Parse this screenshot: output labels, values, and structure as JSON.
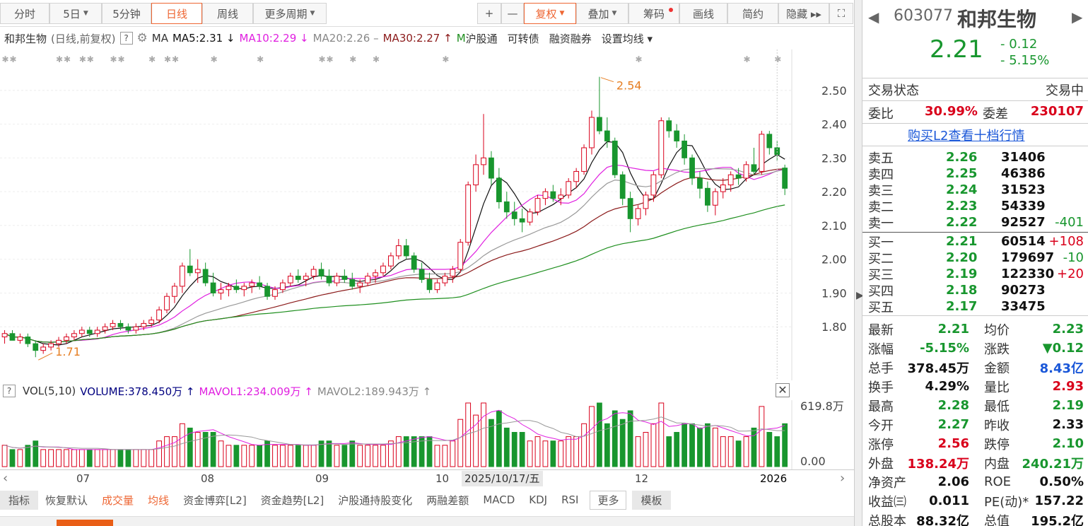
{
  "toolbar": {
    "items": [
      {
        "label": "分时",
        "x": 0,
        "w": 70
      },
      {
        "label": "5日",
        "x": 70,
        "w": 74,
        "dropdown": true
      },
      {
        "label": "5分钟",
        "x": 144,
        "w": 70
      },
      {
        "label": "日线",
        "x": 214,
        "w": 72,
        "active": true
      },
      {
        "label": "周线",
        "x": 286,
        "w": 72
      },
      {
        "label": "更多周期",
        "x": 358,
        "w": 104,
        "dropdown": true
      }
    ],
    "right": [
      {
        "label": "+",
        "x": 675,
        "w": 34
      },
      {
        "label": "—",
        "x": 709,
        "w": 32
      },
      {
        "label": "复权",
        "x": 741,
        "w": 74,
        "dropdown": true,
        "active": true
      },
      {
        "label": "叠加",
        "x": 815,
        "w": 74,
        "dropdown": true
      },
      {
        "label": "筹码",
        "x": 889,
        "w": 72,
        "dot": true
      },
      {
        "label": "画线",
        "x": 961,
        "w": 68
      },
      {
        "label": "简约",
        "x": 1029,
        "w": 72
      },
      {
        "label": "隐藏 ▸▸",
        "x": 1101,
        "w": 72
      },
      {
        "label": "⛶",
        "x": 1173,
        "w": 34
      }
    ]
  },
  "ma_legend": {
    "title": "和邦生物",
    "subtitle": "(日线,前复权)",
    "ma": "MA",
    "ma5": "MA5:2.31 ↓",
    "ma10": "MA10:2.29 ↓",
    "ma20": "MA20:2.26 –",
    "ma30": "MA30:2.27 ↑",
    "links": [
      "沪股通",
      "可转债",
      "融资融券",
      "设置均线 ▾"
    ]
  },
  "colors": {
    "up": "#d9001b",
    "down": "#18962e",
    "ma5": "#111111",
    "ma10": "#e020e0",
    "ma20": "#999999",
    "ma30": "#8b1a1a",
    "ma60": "#1f8f1f"
  },
  "chart_data": {
    "type": "candlestick",
    "ylim": [
      1.7,
      2.6
    ],
    "y_ticks": [
      "2.50",
      "2.40",
      "2.30",
      "2.20",
      "2.10",
      "2.00",
      "1.90",
      "1.80"
    ],
    "x_labels": [
      "07",
      "08",
      "09",
      "10",
      "12"
    ],
    "annotations": [
      "2.54",
      "1.71"
    ],
    "selected_date": "2025/10/17/五",
    "year_label": "2026",
    "ohlc": [
      [
        1.77,
        1.79,
        1.75,
        1.78
      ],
      [
        1.78,
        1.79,
        1.76,
        1.76
      ],
      [
        1.76,
        1.78,
        1.75,
        1.77
      ],
      [
        1.77,
        1.78,
        1.74,
        1.75
      ],
      [
        1.75,
        1.76,
        1.71,
        1.73
      ],
      [
        1.73,
        1.75,
        1.72,
        1.74
      ],
      [
        1.74,
        1.76,
        1.73,
        1.75
      ],
      [
        1.75,
        1.77,
        1.74,
        1.76
      ],
      [
        1.76,
        1.78,
        1.75,
        1.77
      ],
      [
        1.77,
        1.79,
        1.76,
        1.78
      ],
      [
        1.78,
        1.8,
        1.77,
        1.79
      ],
      [
        1.79,
        1.8,
        1.77,
        1.78
      ],
      [
        1.78,
        1.8,
        1.77,
        1.79
      ],
      [
        1.79,
        1.81,
        1.78,
        1.8
      ],
      [
        1.8,
        1.82,
        1.79,
        1.81
      ],
      [
        1.81,
        1.82,
        1.79,
        1.8
      ],
      [
        1.8,
        1.81,
        1.78,
        1.79
      ],
      [
        1.79,
        1.81,
        1.78,
        1.8
      ],
      [
        1.8,
        1.82,
        1.79,
        1.81
      ],
      [
        1.81,
        1.83,
        1.8,
        1.82
      ],
      [
        1.82,
        1.86,
        1.81,
        1.85
      ],
      [
        1.85,
        1.9,
        1.84,
        1.89
      ],
      [
        1.89,
        1.93,
        1.87,
        1.92
      ],
      [
        1.92,
        1.99,
        1.9,
        1.98
      ],
      [
        1.98,
        2.03,
        1.95,
        1.96
      ],
      [
        1.96,
        2.0,
        1.93,
        1.97
      ],
      [
        1.97,
        1.99,
        1.92,
        1.93
      ],
      [
        1.93,
        1.96,
        1.89,
        1.9
      ],
      [
        1.9,
        1.93,
        1.88,
        1.91
      ],
      [
        1.91,
        1.93,
        1.89,
        1.92
      ],
      [
        1.92,
        1.94,
        1.9,
        1.91
      ],
      [
        1.91,
        1.93,
        1.89,
        1.92
      ],
      [
        1.92,
        1.94,
        1.9,
        1.93
      ],
      [
        1.93,
        1.95,
        1.91,
        1.92
      ],
      [
        1.92,
        1.93,
        1.88,
        1.89
      ],
      [
        1.89,
        1.92,
        1.88,
        1.91
      ],
      [
        1.91,
        1.94,
        1.9,
        1.93
      ],
      [
        1.93,
        1.96,
        1.92,
        1.95
      ],
      [
        1.95,
        1.97,
        1.93,
        1.94
      ],
      [
        1.94,
        1.96,
        1.92,
        1.95
      ],
      [
        1.95,
        1.98,
        1.94,
        1.97
      ],
      [
        1.97,
        1.99,
        1.94,
        1.95
      ],
      [
        1.95,
        1.97,
        1.92,
        1.93
      ],
      [
        1.93,
        1.96,
        1.92,
        1.95
      ],
      [
        1.95,
        1.97,
        1.93,
        1.94
      ],
      [
        1.94,
        1.96,
        1.91,
        1.92
      ],
      [
        1.92,
        1.94,
        1.9,
        1.93
      ],
      [
        1.93,
        1.96,
        1.92,
        1.95
      ],
      [
        1.95,
        1.97,
        1.93,
        1.96
      ],
      [
        1.96,
        1.99,
        1.95,
        1.98
      ],
      [
        1.98,
        2.02,
        1.97,
        2.01
      ],
      [
        2.01,
        2.06,
        2.0,
        2.04
      ],
      [
        2.04,
        2.06,
        2.0,
        2.01
      ],
      [
        2.01,
        2.02,
        1.96,
        1.97
      ],
      [
        1.97,
        1.99,
        1.93,
        1.94
      ],
      [
        1.94,
        1.96,
        1.9,
        1.91
      ],
      [
        1.91,
        1.94,
        1.9,
        1.93
      ],
      [
        1.93,
        1.96,
        1.92,
        1.95
      ],
      [
        1.95,
        1.98,
        1.93,
        1.97
      ],
      [
        1.97,
        2.06,
        1.96,
        2.05
      ],
      [
        2.05,
        2.23,
        2.04,
        2.22
      ],
      [
        2.22,
        2.31,
        2.2,
        2.28
      ],
      [
        2.28,
        2.43,
        2.25,
        2.3
      ],
      [
        2.3,
        2.32,
        2.22,
        2.24
      ],
      [
        2.24,
        2.27,
        2.15,
        2.17
      ],
      [
        2.17,
        2.2,
        2.12,
        2.14
      ],
      [
        2.14,
        2.17,
        2.1,
        2.12
      ],
      [
        2.12,
        2.15,
        2.08,
        2.11
      ],
      [
        2.11,
        2.15,
        2.1,
        2.14
      ],
      [
        2.14,
        2.19,
        2.13,
        2.18
      ],
      [
        2.18,
        2.21,
        2.16,
        2.2
      ],
      [
        2.2,
        2.22,
        2.17,
        2.18
      ],
      [
        2.18,
        2.21,
        2.16,
        2.19
      ],
      [
        2.19,
        2.24,
        2.18,
        2.23
      ],
      [
        2.23,
        2.27,
        2.21,
        2.26
      ],
      [
        2.26,
        2.34,
        2.25,
        2.33
      ],
      [
        2.33,
        2.44,
        2.31,
        2.42
      ],
      [
        2.42,
        2.54,
        2.37,
        2.38
      ],
      [
        2.38,
        2.42,
        2.33,
        2.35
      ],
      [
        2.35,
        2.36,
        2.24,
        2.25
      ],
      [
        2.25,
        2.26,
        2.16,
        2.18
      ],
      [
        2.18,
        2.2,
        2.08,
        2.12
      ],
      [
        2.12,
        2.16,
        2.1,
        2.15
      ],
      [
        2.15,
        2.2,
        2.13,
        2.19
      ],
      [
        2.19,
        2.26,
        2.17,
        2.25
      ],
      [
        2.25,
        2.42,
        2.24,
        2.41
      ],
      [
        2.41,
        2.42,
        2.36,
        2.38
      ],
      [
        2.38,
        2.4,
        2.33,
        2.35
      ],
      [
        2.35,
        2.37,
        2.28,
        2.3
      ],
      [
        2.3,
        2.31,
        2.22,
        2.24
      ],
      [
        2.24,
        2.26,
        2.18,
        2.21
      ],
      [
        2.21,
        2.23,
        2.14,
        2.16
      ],
      [
        2.16,
        2.21,
        2.13,
        2.2
      ],
      [
        2.2,
        2.24,
        2.18,
        2.22
      ],
      [
        2.22,
        2.26,
        2.2,
        2.25
      ],
      [
        2.25,
        2.27,
        2.22,
        2.24
      ],
      [
        2.24,
        2.29,
        2.23,
        2.28
      ],
      [
        2.28,
        2.33,
        2.25,
        2.26
      ],
      [
        2.26,
        2.38,
        2.25,
        2.37
      ],
      [
        2.37,
        2.38,
        2.31,
        2.33
      ],
      [
        2.33,
        2.35,
        2.29,
        2.31
      ],
      [
        2.27,
        2.28,
        2.19,
        2.21
      ]
    ],
    "volume": {
      "ylim": [
        0,
        619.8
      ],
      "y_ticks": [
        "619.8万",
        "0.00"
      ],
      "unit": "万"
    }
  },
  "vol_legend": {
    "q": "?",
    "name": "VOL(5,10)",
    "volume": "VOLUME:378.450万 ↑",
    "mavol1": "MAVOL1:234.009万 ↑",
    "mavol2": "MAVOL2:189.943万 ↑"
  },
  "tabs": [
    "指标",
    "恢复默认",
    "成交量",
    "均线",
    "资金博弈[L2]",
    "资金趋势[L2]",
    "沪股通持股变化",
    "两融差额",
    "MACD",
    "KDJ",
    "RSI",
    "更多",
    "模板"
  ],
  "panel": {
    "code": "603077",
    "name": "和邦生物",
    "price": "2.21",
    "change": "- 0.12",
    "change_pct": "- 5.15%",
    "trade_status_label": "交易状态",
    "trade_status": "交易中",
    "weibi_label": "委比",
    "weibi": "30.99%",
    "weicha_label": "委差",
    "weicha": "230107",
    "l2_link": "购买L2查看十档行情",
    "asks": [
      [
        "卖五",
        "2.26",
        "31406",
        ""
      ],
      [
        "卖四",
        "2.25",
        "46386",
        ""
      ],
      [
        "卖三",
        "2.24",
        "31523",
        ""
      ],
      [
        "卖二",
        "2.23",
        "54339",
        ""
      ],
      [
        "卖一",
        "2.22",
        "92527",
        "-401"
      ]
    ],
    "bids": [
      [
        "买一",
        "2.21",
        "60514",
        "+108"
      ],
      [
        "买二",
        "2.20",
        "179697",
        "-10"
      ],
      [
        "买三",
        "2.19",
        "122330",
        "+20"
      ],
      [
        "买四",
        "2.18",
        "90273",
        ""
      ],
      [
        "买五",
        "2.17",
        "33475",
        ""
      ]
    ],
    "stats": [
      [
        "最新",
        "2.21",
        "g",
        "均价",
        "2.23",
        "g"
      ],
      [
        "涨幅",
        "-5.15%",
        "g",
        "涨跌",
        "▼0.12",
        "g"
      ],
      [
        "总手",
        "378.45万",
        "k",
        "金额",
        "8.43亿",
        "b"
      ],
      [
        "换手",
        "4.29%",
        "k",
        "量比",
        "2.93",
        "r"
      ],
      [
        "最高",
        "2.28",
        "g",
        "最低",
        "2.19",
        "g"
      ],
      [
        "今开",
        "2.27",
        "g",
        "昨收",
        "2.33",
        "k"
      ],
      [
        "涨停",
        "2.56",
        "r",
        "跌停",
        "2.10",
        "g"
      ],
      [
        "外盘",
        "138.24万",
        "r",
        "内盘",
        "240.21万",
        "g"
      ],
      [
        "净资产",
        "2.06",
        "k",
        "ROE",
        "0.50%",
        "k"
      ],
      [
        "收益㈢",
        "0.011",
        "k",
        "PE(动)*",
        "157.22",
        "k"
      ],
      [
        "总股本",
        "88.32亿",
        "k",
        "总值",
        "195.2亿",
        "k"
      ]
    ]
  }
}
